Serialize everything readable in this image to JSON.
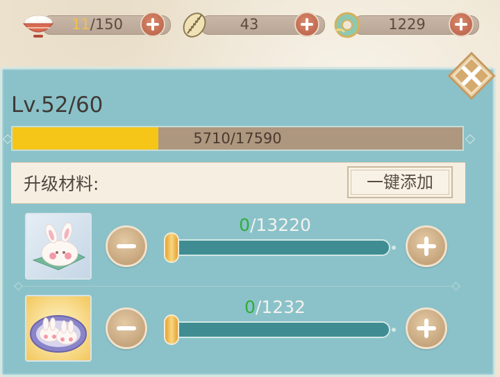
{
  "resources": [
    {
      "icon": "rice-bowl-icon",
      "current": "11",
      "sep_max": "/150"
    },
    {
      "icon": "dumpling-icon",
      "value": "43"
    },
    {
      "icon": "jade-coin-icon",
      "value": "1229"
    }
  ],
  "panel": {
    "level": "Lv.52/60",
    "xp_text": "5710/17590",
    "xp_fraction": 0.3246,
    "materials_label": "升级材料:",
    "add_all_button": "一键添加"
  },
  "materials": [
    {
      "icon": "bunny-bun-icon",
      "selected": "0",
      "total": "/13220",
      "slider_value": 0
    },
    {
      "icon": "bunny-bun-plate-icon",
      "selected": "0",
      "total": "/1232",
      "slider_value": 0
    }
  ],
  "colors": {
    "panel": "#8bc2c9",
    "xp_fill": "#f5c518",
    "selected_count": "#2fae3a",
    "accent_plus": "#b55c44"
  }
}
